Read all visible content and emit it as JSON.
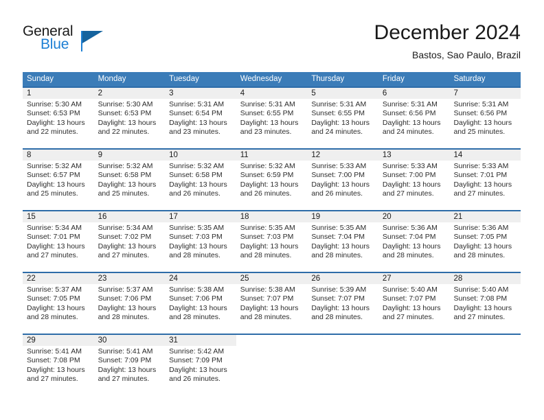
{
  "logo": {
    "primary_text": "General",
    "secondary_text": "Blue",
    "primary_color": "#1a1a1a",
    "secondary_color": "#1c7fd4",
    "mark": "blue-triangle"
  },
  "header": {
    "title": "December 2024",
    "location": "Bastos, Sao Paulo, Brazil"
  },
  "theme": {
    "header_bg": "#3b7cb8",
    "header_text": "#ffffff",
    "row_rule": "#2d6ca8",
    "day_band_bg": "#efefef",
    "cell_bg": "#ffffff",
    "body_text": "#2b2b2b"
  },
  "weekdays": [
    "Sunday",
    "Monday",
    "Tuesday",
    "Wednesday",
    "Thursday",
    "Friday",
    "Saturday"
  ],
  "weeks": [
    [
      {
        "day": "1",
        "sunrise": "Sunrise: 5:30 AM",
        "sunset": "Sunset: 6:53 PM",
        "daylight_1": "Daylight: 13 hours",
        "daylight_2": "and 22 minutes."
      },
      {
        "day": "2",
        "sunrise": "Sunrise: 5:30 AM",
        "sunset": "Sunset: 6:53 PM",
        "daylight_1": "Daylight: 13 hours",
        "daylight_2": "and 22 minutes."
      },
      {
        "day": "3",
        "sunrise": "Sunrise: 5:31 AM",
        "sunset": "Sunset: 6:54 PM",
        "daylight_1": "Daylight: 13 hours",
        "daylight_2": "and 23 minutes."
      },
      {
        "day": "4",
        "sunrise": "Sunrise: 5:31 AM",
        "sunset": "Sunset: 6:55 PM",
        "daylight_1": "Daylight: 13 hours",
        "daylight_2": "and 23 minutes."
      },
      {
        "day": "5",
        "sunrise": "Sunrise: 5:31 AM",
        "sunset": "Sunset: 6:55 PM",
        "daylight_1": "Daylight: 13 hours",
        "daylight_2": "and 24 minutes."
      },
      {
        "day": "6",
        "sunrise": "Sunrise: 5:31 AM",
        "sunset": "Sunset: 6:56 PM",
        "daylight_1": "Daylight: 13 hours",
        "daylight_2": "and 24 minutes."
      },
      {
        "day": "7",
        "sunrise": "Sunrise: 5:31 AM",
        "sunset": "Sunset: 6:56 PM",
        "daylight_1": "Daylight: 13 hours",
        "daylight_2": "and 25 minutes."
      }
    ],
    [
      {
        "day": "8",
        "sunrise": "Sunrise: 5:32 AM",
        "sunset": "Sunset: 6:57 PM",
        "daylight_1": "Daylight: 13 hours",
        "daylight_2": "and 25 minutes."
      },
      {
        "day": "9",
        "sunrise": "Sunrise: 5:32 AM",
        "sunset": "Sunset: 6:58 PM",
        "daylight_1": "Daylight: 13 hours",
        "daylight_2": "and 25 minutes."
      },
      {
        "day": "10",
        "sunrise": "Sunrise: 5:32 AM",
        "sunset": "Sunset: 6:58 PM",
        "daylight_1": "Daylight: 13 hours",
        "daylight_2": "and 26 minutes."
      },
      {
        "day": "11",
        "sunrise": "Sunrise: 5:32 AM",
        "sunset": "Sunset: 6:59 PM",
        "daylight_1": "Daylight: 13 hours",
        "daylight_2": "and 26 minutes."
      },
      {
        "day": "12",
        "sunrise": "Sunrise: 5:33 AM",
        "sunset": "Sunset: 7:00 PM",
        "daylight_1": "Daylight: 13 hours",
        "daylight_2": "and 26 minutes."
      },
      {
        "day": "13",
        "sunrise": "Sunrise: 5:33 AM",
        "sunset": "Sunset: 7:00 PM",
        "daylight_1": "Daylight: 13 hours",
        "daylight_2": "and 27 minutes."
      },
      {
        "day": "14",
        "sunrise": "Sunrise: 5:33 AM",
        "sunset": "Sunset: 7:01 PM",
        "daylight_1": "Daylight: 13 hours",
        "daylight_2": "and 27 minutes."
      }
    ],
    [
      {
        "day": "15",
        "sunrise": "Sunrise: 5:34 AM",
        "sunset": "Sunset: 7:01 PM",
        "daylight_1": "Daylight: 13 hours",
        "daylight_2": "and 27 minutes."
      },
      {
        "day": "16",
        "sunrise": "Sunrise: 5:34 AM",
        "sunset": "Sunset: 7:02 PM",
        "daylight_1": "Daylight: 13 hours",
        "daylight_2": "and 27 minutes."
      },
      {
        "day": "17",
        "sunrise": "Sunrise: 5:35 AM",
        "sunset": "Sunset: 7:03 PM",
        "daylight_1": "Daylight: 13 hours",
        "daylight_2": "and 28 minutes."
      },
      {
        "day": "18",
        "sunrise": "Sunrise: 5:35 AM",
        "sunset": "Sunset: 7:03 PM",
        "daylight_1": "Daylight: 13 hours",
        "daylight_2": "and 28 minutes."
      },
      {
        "day": "19",
        "sunrise": "Sunrise: 5:35 AM",
        "sunset": "Sunset: 7:04 PM",
        "daylight_1": "Daylight: 13 hours",
        "daylight_2": "and 28 minutes."
      },
      {
        "day": "20",
        "sunrise": "Sunrise: 5:36 AM",
        "sunset": "Sunset: 7:04 PM",
        "daylight_1": "Daylight: 13 hours",
        "daylight_2": "and 28 minutes."
      },
      {
        "day": "21",
        "sunrise": "Sunrise: 5:36 AM",
        "sunset": "Sunset: 7:05 PM",
        "daylight_1": "Daylight: 13 hours",
        "daylight_2": "and 28 minutes."
      }
    ],
    [
      {
        "day": "22",
        "sunrise": "Sunrise: 5:37 AM",
        "sunset": "Sunset: 7:05 PM",
        "daylight_1": "Daylight: 13 hours",
        "daylight_2": "and 28 minutes."
      },
      {
        "day": "23",
        "sunrise": "Sunrise: 5:37 AM",
        "sunset": "Sunset: 7:06 PM",
        "daylight_1": "Daylight: 13 hours",
        "daylight_2": "and 28 minutes."
      },
      {
        "day": "24",
        "sunrise": "Sunrise: 5:38 AM",
        "sunset": "Sunset: 7:06 PM",
        "daylight_1": "Daylight: 13 hours",
        "daylight_2": "and 28 minutes."
      },
      {
        "day": "25",
        "sunrise": "Sunrise: 5:38 AM",
        "sunset": "Sunset: 7:07 PM",
        "daylight_1": "Daylight: 13 hours",
        "daylight_2": "and 28 minutes."
      },
      {
        "day": "26",
        "sunrise": "Sunrise: 5:39 AM",
        "sunset": "Sunset: 7:07 PM",
        "daylight_1": "Daylight: 13 hours",
        "daylight_2": "and 28 minutes."
      },
      {
        "day": "27",
        "sunrise": "Sunrise: 5:40 AM",
        "sunset": "Sunset: 7:07 PM",
        "daylight_1": "Daylight: 13 hours",
        "daylight_2": "and 27 minutes."
      },
      {
        "day": "28",
        "sunrise": "Sunrise: 5:40 AM",
        "sunset": "Sunset: 7:08 PM",
        "daylight_1": "Daylight: 13 hours",
        "daylight_2": "and 27 minutes."
      }
    ],
    [
      {
        "day": "29",
        "sunrise": "Sunrise: 5:41 AM",
        "sunset": "Sunset: 7:08 PM",
        "daylight_1": "Daylight: 13 hours",
        "daylight_2": "and 27 minutes."
      },
      {
        "day": "30",
        "sunrise": "Sunrise: 5:41 AM",
        "sunset": "Sunset: 7:09 PM",
        "daylight_1": "Daylight: 13 hours",
        "daylight_2": "and 27 minutes."
      },
      {
        "day": "31",
        "sunrise": "Sunrise: 5:42 AM",
        "sunset": "Sunset: 7:09 PM",
        "daylight_1": "Daylight: 13 hours",
        "daylight_2": "and 26 minutes."
      },
      {
        "day": "",
        "sunrise": "",
        "sunset": "",
        "daylight_1": "",
        "daylight_2": ""
      },
      {
        "day": "",
        "sunrise": "",
        "sunset": "",
        "daylight_1": "",
        "daylight_2": ""
      },
      {
        "day": "",
        "sunrise": "",
        "sunset": "",
        "daylight_1": "",
        "daylight_2": ""
      },
      {
        "day": "",
        "sunrise": "",
        "sunset": "",
        "daylight_1": "",
        "daylight_2": ""
      }
    ]
  ]
}
